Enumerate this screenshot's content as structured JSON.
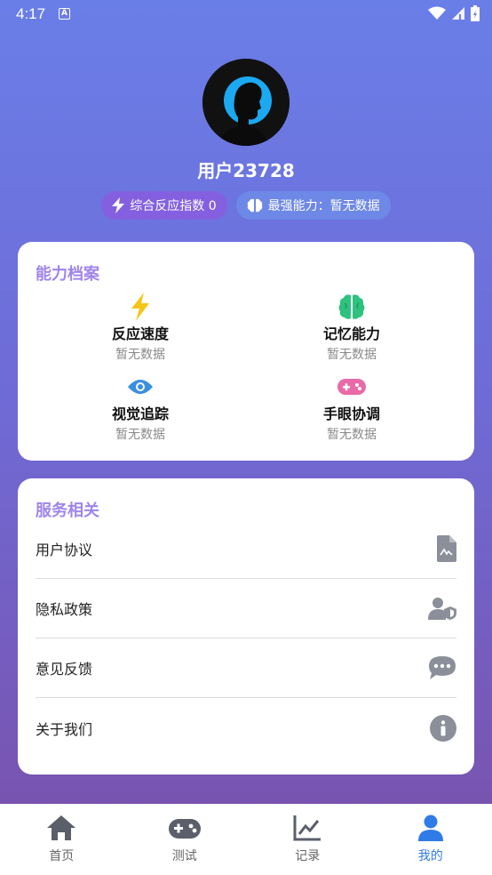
{
  "status_bar": {
    "time": "4:17",
    "notif_letter": "A"
  },
  "profile": {
    "username": "用户23728",
    "chip_reaction": "综合反应指数 0",
    "chip_strongest": "最强能力：暂无数据"
  },
  "ability_card": {
    "title": "能力档案",
    "items": [
      {
        "name": "反应速度",
        "value": "暂无数据",
        "icon": "lightning-icon",
        "color": "#f5c518"
      },
      {
        "name": "记忆能力",
        "value": "暂无数据",
        "icon": "brain-icon",
        "color": "#2ec27e"
      },
      {
        "name": "视觉追踪",
        "value": "暂无数据",
        "icon": "eye-icon",
        "color": "#3b8fe0"
      },
      {
        "name": "手眼协调",
        "value": "暂无数据",
        "icon": "gamepad-icon",
        "color": "#e96aa6"
      }
    ]
  },
  "service_card": {
    "title": "服务相关",
    "items": [
      {
        "label": "用户协议",
        "icon": "document-icon"
      },
      {
        "label": "隐私政策",
        "icon": "user-shield-icon"
      },
      {
        "label": "意见反馈",
        "icon": "chat-icon"
      },
      {
        "label": "关于我们",
        "icon": "info-icon"
      }
    ]
  },
  "nav": {
    "items": [
      {
        "label": "首页",
        "icon": "home-icon",
        "active": false
      },
      {
        "label": "测试",
        "icon": "gamepad-icon",
        "active": false
      },
      {
        "label": "记录",
        "icon": "chart-icon",
        "active": false
      },
      {
        "label": "我的",
        "icon": "user-icon",
        "active": true
      }
    ]
  },
  "colors": {
    "accent": "#2f7be8",
    "card_title": "#9f85ea",
    "icon_gray": "#8a8f9a"
  }
}
